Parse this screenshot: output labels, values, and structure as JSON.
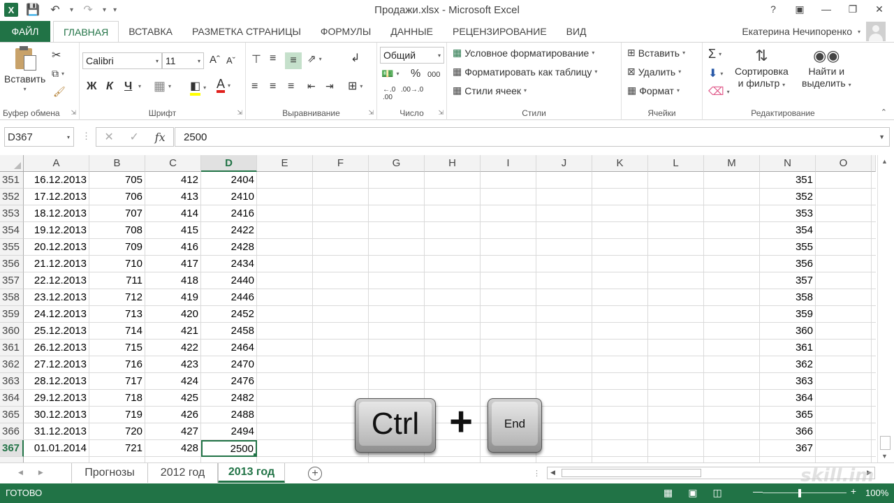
{
  "window": {
    "title": "Продажи.xlsx - Microsoft Excel",
    "app_icon": "X",
    "controls": [
      "?",
      "ribbon-display-icon",
      "minimize-icon",
      "restore-icon",
      "close-icon"
    ]
  },
  "tabs": {
    "file": "ФАЙЛ",
    "items": [
      "ГЛАВНАЯ",
      "ВСТАВКА",
      "РАЗМЕТКА СТРАНИЦЫ",
      "ФОРМУЛЫ",
      "ДАННЫЕ",
      "РЕЦЕНЗИРОВАНИЕ",
      "ВИД"
    ],
    "active": "ГЛАВНАЯ",
    "user": "Екатерина Нечипоренко"
  },
  "ribbon": {
    "clipboard": {
      "label": "Буфер обмена",
      "paste": "Вставить"
    },
    "font": {
      "label": "Шрифт",
      "name": "Calibri",
      "size": "11",
      "bold": "Ж",
      "italic": "К",
      "underline": "Ч"
    },
    "alignment": {
      "label": "Выравнивание"
    },
    "number": {
      "label": "Число",
      "format": "Общий",
      "percent": "%",
      "thousands": "000"
    },
    "styles": {
      "label": "Стили",
      "conditional": "Условное форматирование",
      "as_table": "Форматировать как таблицу",
      "cell_styles": "Стили ячеек"
    },
    "cells": {
      "label": "Ячейки",
      "insert": "Вставить",
      "delete": "Удалить",
      "format": "Формат"
    },
    "editing": {
      "label": "Редактирование",
      "sort_line1": "Сортировка",
      "sort_line2": "и фильтр",
      "find_line1": "Найти и",
      "find_line2": "выделить"
    }
  },
  "formula_bar": {
    "name_box": "D367",
    "value": "2500"
  },
  "sheet": {
    "columns": [
      "A",
      "B",
      "C",
      "D",
      "E",
      "F",
      "G",
      "H",
      "I",
      "J",
      "K",
      "L",
      "M",
      "N",
      "O"
    ],
    "selected_column": "D",
    "selected_row": "367",
    "rows": [
      {
        "n": "351",
        "a": "16.12.2013",
        "b": "705",
        "c": "412",
        "d": "2404"
      },
      {
        "n": "352",
        "a": "17.12.2013",
        "b": "706",
        "c": "413",
        "d": "2410"
      },
      {
        "n": "353",
        "a": "18.12.2013",
        "b": "707",
        "c": "414",
        "d": "2416"
      },
      {
        "n": "354",
        "a": "19.12.2013",
        "b": "708",
        "c": "415",
        "d": "2422"
      },
      {
        "n": "355",
        "a": "20.12.2013",
        "b": "709",
        "c": "416",
        "d": "2428"
      },
      {
        "n": "356",
        "a": "21.12.2013",
        "b": "710",
        "c": "417",
        "d": "2434"
      },
      {
        "n": "357",
        "a": "22.12.2013",
        "b": "711",
        "c": "418",
        "d": "2440"
      },
      {
        "n": "358",
        "a": "23.12.2013",
        "b": "712",
        "c": "419",
        "d": "2446"
      },
      {
        "n": "359",
        "a": "24.12.2013",
        "b": "713",
        "c": "420",
        "d": "2452"
      },
      {
        "n": "360",
        "a": "25.12.2013",
        "b": "714",
        "c": "421",
        "d": "2458"
      },
      {
        "n": "361",
        "a": "26.12.2013",
        "b": "715",
        "c": "422",
        "d": "2464"
      },
      {
        "n": "362",
        "a": "27.12.2013",
        "b": "716",
        "c": "423",
        "d": "2470"
      },
      {
        "n": "363",
        "a": "28.12.2013",
        "b": "717",
        "c": "424",
        "d": "2476"
      },
      {
        "n": "364",
        "a": "29.12.2013",
        "b": "718",
        "c": "425",
        "d": "2482"
      },
      {
        "n": "365",
        "a": "30.12.2013",
        "b": "719",
        "c": "426",
        "d": "2488"
      },
      {
        "n": "366",
        "a": "31.12.2013",
        "b": "720",
        "c": "427",
        "d": "2494"
      },
      {
        "n": "367",
        "a": "01.01.2014",
        "b": "721",
        "c": "428",
        "d": "2500"
      }
    ]
  },
  "sheet_tabs": {
    "items": [
      "Прогнозы",
      "2012 год",
      "2013 год"
    ],
    "active": "2013 год",
    "add": "+"
  },
  "status": {
    "text": "ГОТОВО",
    "zoom": "100%"
  },
  "overlay": {
    "key1": "Ctrl",
    "plus": "+",
    "key2": "End",
    "watermark": "skill.im"
  },
  "colors": {
    "accent": "#217346",
    "header_bg": "#f3f3f3",
    "gridline": "#dadada"
  }
}
